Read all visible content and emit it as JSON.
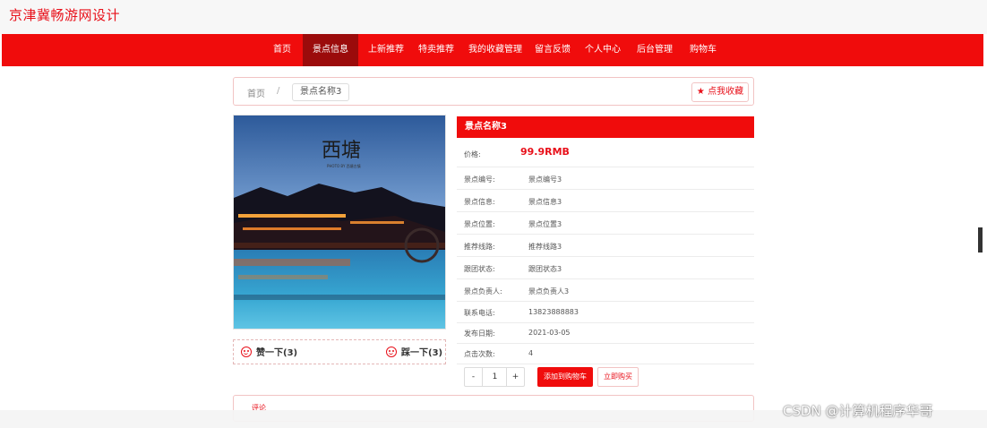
{
  "site_title": "京津冀畅游网设计",
  "nav": {
    "items": [
      "首页",
      "景点信息",
      "上新推荐",
      "特卖推荐",
      "我的收藏管理",
      "留言反馈",
      "个人中心",
      "后台管理",
      "购物车"
    ],
    "active_index": 1
  },
  "breadcrumb": {
    "home": "首页",
    "separator": "/",
    "current": "景点名称3"
  },
  "favorite_button": "★ 点我收藏",
  "image": {
    "calligraphy": "西塘",
    "subtitle": "PHOTO BY 西塘古镇"
  },
  "votes": {
    "like": "赞一下(3)",
    "dislike": "踩一下(3)"
  },
  "detail": {
    "title": "景点名称3",
    "price_label": "价格:",
    "price_value": "99.9RMB",
    "fields": [
      {
        "label": "景点编号:",
        "value": "景点编号3"
      },
      {
        "label": "景点信息:",
        "value": "景点信息3"
      },
      {
        "label": "景点位置:",
        "value": "景点位置3"
      },
      {
        "label": "推荐线路:",
        "value": "推荐线路3"
      },
      {
        "label": "跟团状态:",
        "value": "跟团状态3"
      },
      {
        "label": "景点负责人:",
        "value": "景点负责人3"
      },
      {
        "label": "联系电话:",
        "value": "13823888883"
      },
      {
        "label": "发布日期:",
        "value": "2021-03-05"
      },
      {
        "label": "点击次数:",
        "value": "4"
      }
    ]
  },
  "quantity": {
    "minus": "-",
    "value": "1",
    "plus": "+"
  },
  "buttons": {
    "add_to_cart": "添加到购物车",
    "buy_now": "立即购买"
  },
  "comments": {
    "title": "评论"
  },
  "watermark": "CSDN @计算机程序华哥",
  "colors": {
    "brand_red": "#f00c0c",
    "active_nav": "#9b0b0b",
    "text_red": "#e8101a"
  }
}
